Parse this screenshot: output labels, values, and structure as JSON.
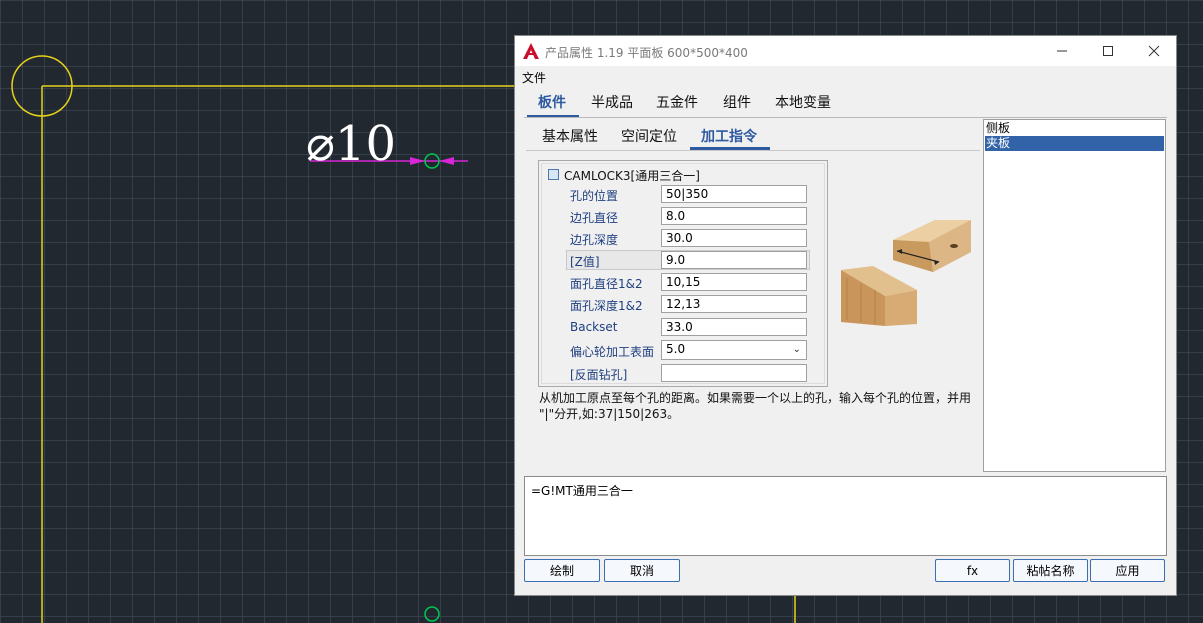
{
  "cad": {
    "dimension_text": "⌀10",
    "line_color": "#e6d21a",
    "circle_color": "#00c853",
    "dim_color": "#d626d6"
  },
  "dialog": {
    "title": "产品属性 1.19 平面板 600*500*400",
    "window_controls": [
      "minimize-icon",
      "maximize-icon",
      "close-icon"
    ],
    "menu": {
      "file": "文件"
    },
    "main_tabs": [
      {
        "label": "板件",
        "active": true
      },
      {
        "label": "半成品",
        "active": false
      },
      {
        "label": "五金件",
        "active": false
      },
      {
        "label": "组件",
        "active": false
      },
      {
        "label": "本地变量",
        "active": false
      }
    ],
    "sub_tabs": [
      {
        "label": "基本属性",
        "active": false
      },
      {
        "label": "空间定位",
        "active": false
      },
      {
        "label": "加工指令",
        "active": true
      }
    ],
    "property_group": {
      "title": "CAMLOCK3[通用三合一]",
      "rows": [
        {
          "label": "孔的位置",
          "value": "50|350"
        },
        {
          "label": "边孔直径",
          "value": "8.0"
        },
        {
          "label": "边孔深度",
          "value": "30.0"
        },
        {
          "label": "[Z值]",
          "value": "9.0",
          "selected": true
        },
        {
          "label": "面孔直径1&2",
          "value": "10,15"
        },
        {
          "label": "面孔深度1&2",
          "value": "12,13"
        },
        {
          "label": "Backset",
          "value": "33.0"
        },
        {
          "label": "偏心轮加工表面",
          "value": "5.0",
          "dropdown": true
        },
        {
          "label": "[反面钻孔]",
          "value": ""
        }
      ]
    },
    "hint": "从机加工原点至每个孔的距离。如果需要一个以上的孔，输入每个孔的位置，并用 \"|\"分开,如:37|150|263。",
    "side_list": [
      {
        "label": "侧板",
        "selected": false
      },
      {
        "label": "夹板",
        "selected": true
      }
    ],
    "formula": "=G!MT通用三合一",
    "buttons": {
      "draw": "绘制",
      "cancel": "取消",
      "fx": "fx",
      "paste_name": "粘帖名称",
      "apply": "应用"
    },
    "accent_color": "#2d5aa0"
  }
}
